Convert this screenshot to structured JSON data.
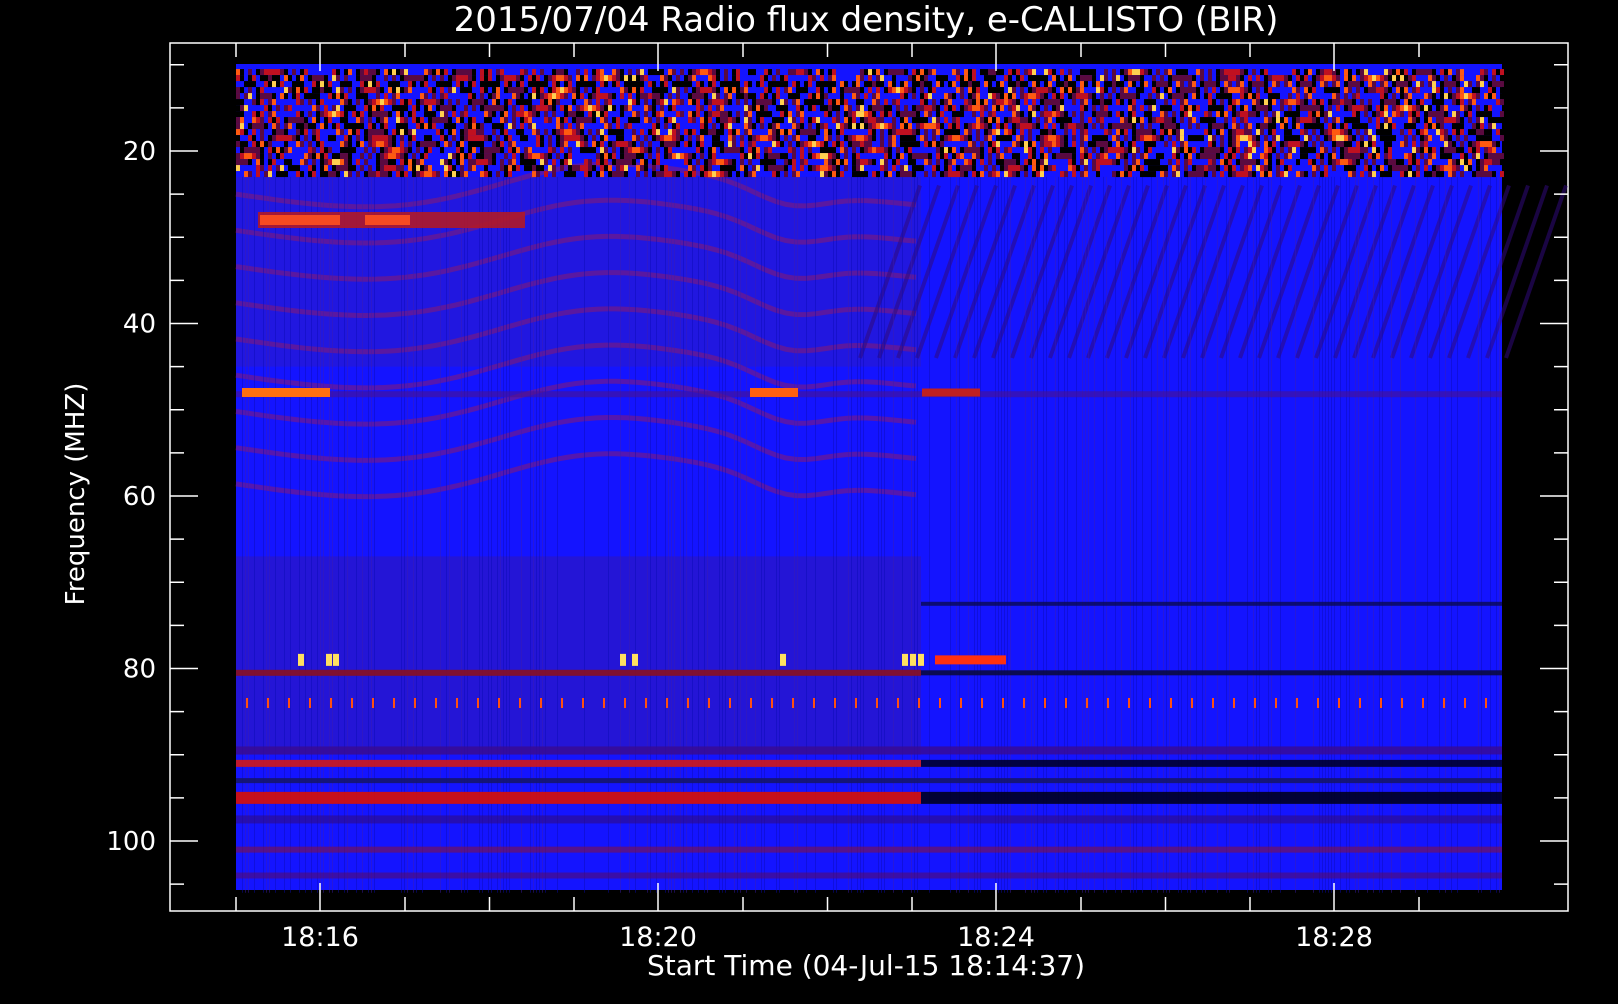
{
  "chart_data": {
    "type": "heatmap",
    "title": "2015/07/04  Radio flux density, e-CALLISTO (BIR)",
    "xlabel": "Start Time (04-Jul-15 18:14:37)",
    "ylabel": "Frequency (MHZ)",
    "x_ticks": [
      "18:16",
      "18:20",
      "18:24",
      "18:28"
    ],
    "y_ticks": [
      "20",
      "40",
      "60",
      "80",
      "100"
    ],
    "y_tick_values": [
      20,
      40,
      60,
      80,
      100
    ],
    "xlim": [
      "18:14:37",
      "18:30:00"
    ],
    "ylim": [
      106,
      10
    ],
    "y_inverted": true,
    "colormap": "blue-red-yellow",
    "colors": {
      "background": "#000000",
      "low": "#1414ff",
      "mid": "#8a1a6e",
      "high": "#ff4a00",
      "peak": "#ffe060",
      "axes": "#ffffff"
    },
    "features": [
      {
        "label": "broadband RFI, upper band",
        "freq_range_mhz": [
          10,
          23
        ]
      },
      {
        "label": "narrowband line",
        "freq_mhz": 28
      },
      {
        "label": "narrowband line",
        "freq_mhz": 48
      },
      {
        "label": "narrowband line",
        "freq_mhz": 79
      },
      {
        "label": "narrowband line",
        "freq_mhz": 84
      },
      {
        "label": "narrowband line",
        "freq_mhz": 91
      },
      {
        "label": "narrowband line",
        "freq_mhz": 95
      }
    ]
  }
}
